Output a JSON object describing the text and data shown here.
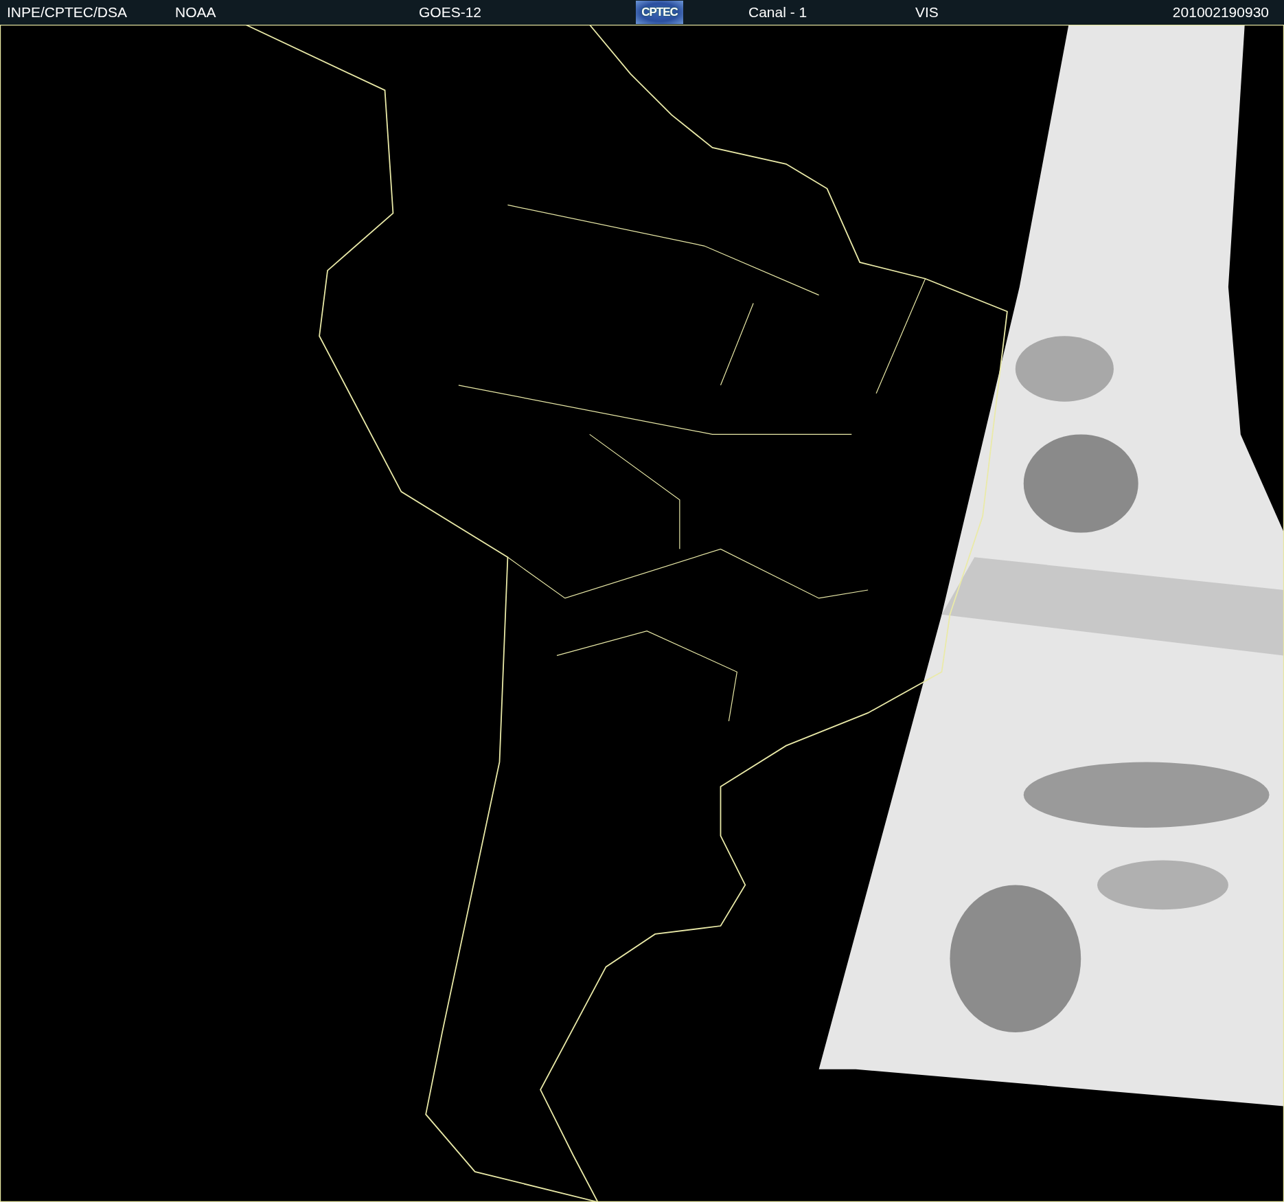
{
  "header": {
    "items": [
      {
        "kind": "text",
        "text": "INPE/CPTEC/DSA"
      },
      {
        "kind": "text",
        "text": "NOAA"
      },
      {
        "kind": "text",
        "text": "GOES-12"
      },
      {
        "kind": "logo",
        "text": "CPTEC"
      },
      {
        "kind": "text",
        "text": "Canal - 1"
      },
      {
        "kind": "text",
        "text": "VIS"
      },
      {
        "kind": "text",
        "text": "201002190930"
      }
    ]
  }
}
